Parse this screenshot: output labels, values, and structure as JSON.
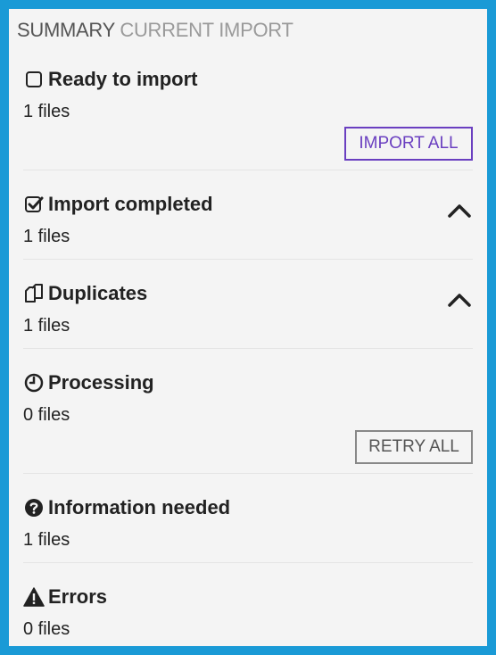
{
  "header": {
    "title": "SUMMARY",
    "subtitle": "CURRENT IMPORT"
  },
  "sections": [
    {
      "id": "ready",
      "title": "Ready to import",
      "count": "1 files",
      "icon": "square-outline-icon",
      "action": "IMPORT ALL"
    },
    {
      "id": "completed",
      "title": "Import completed",
      "count": "1 files",
      "icon": "check-square-icon"
    },
    {
      "id": "duplicates",
      "title": "Duplicates",
      "count": "1 files",
      "icon": "copy-icon"
    },
    {
      "id": "processing",
      "title": "Processing",
      "count": "0 files",
      "icon": "clock-icon",
      "action": "RETRY ALL"
    },
    {
      "id": "info",
      "title": "Information needed",
      "count": "1 files",
      "icon": "question-circle-icon"
    },
    {
      "id": "errors",
      "title": "Errors",
      "count": "0 files",
      "icon": "warning-icon"
    }
  ],
  "colors": {
    "frame": "#1a9ad6",
    "panel": "#f4f4f4",
    "import_button": "#6a3fc0",
    "retry_button": "#888888"
  }
}
